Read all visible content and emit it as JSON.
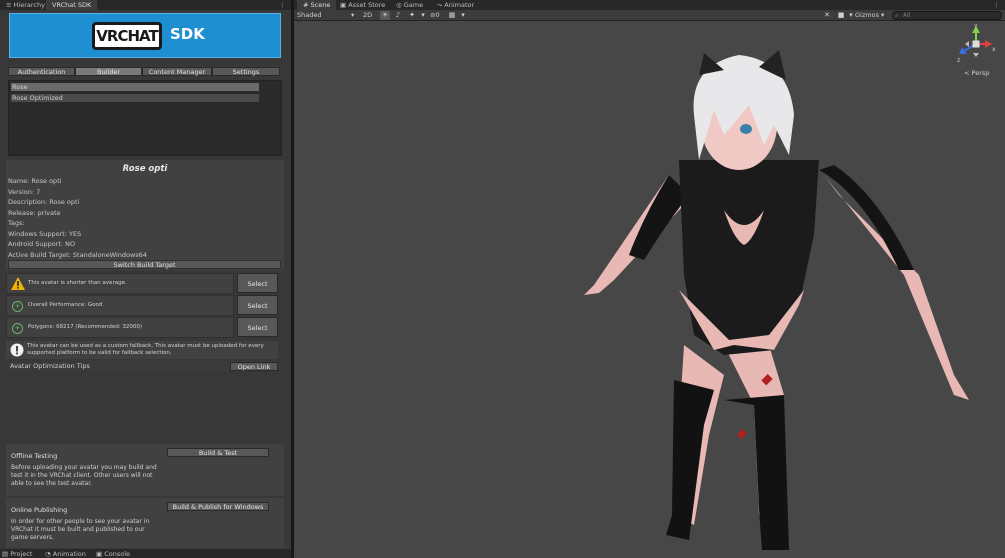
{
  "left_tabs": [
    "Hierarchy",
    "VRChat SDK"
  ],
  "banner": {
    "logo": "VRCHAT",
    "sdk": "SDK"
  },
  "sdk_tabs": [
    "Authentication",
    "Builder",
    "Content Manager",
    "Settings"
  ],
  "avatar_list": [
    "Rose",
    "Rose Optimized"
  ],
  "info": {
    "title": "Rose opti",
    "lines": [
      "Name: Rose opti",
      "Version: 7",
      "Description: Rose opti",
      "Release: private",
      "Tags:",
      "Windows Support: YES",
      "Android Support: NO",
      "Active Build Target: StandaloneWindows64"
    ],
    "switch_button": "Switch Build Target"
  },
  "warnings": [
    {
      "icon": "warning-icon",
      "text": "This avatar is shorter than average.",
      "button": "Select"
    },
    {
      "icon": "ok-icon",
      "text": "Overall Performance: Good",
      "button": "Select"
    },
    {
      "icon": "ok-icon",
      "text": "Polygons: 68217 (Recommended: 32000)",
      "button": "Select"
    }
  ],
  "fallback_text": "This avatar can be used as a custom fallback. This avatar must be uploaded for every supported platform to be valid for fallback selection.",
  "tips": {
    "label": "Avatar Optimization Tips",
    "button": "Open Link"
  },
  "offline": {
    "title": "Offline Testing",
    "button": "Build & Test",
    "text": "Before uploading your avatar you may build and test it in the VRChat client. Other users will not able to see the test avatar."
  },
  "online": {
    "title": "Online Publishing",
    "button": "Build & Publish for Windows",
    "text": "In order for other people to see your avatar in VRChat it must be built and published to our game servers."
  },
  "bottom_tabs": [
    "Project",
    "Animation",
    "Console"
  ],
  "scene_tabs": [
    "Scene",
    "Asset Store",
    "Game",
    "Animator"
  ],
  "toolbar": {
    "shading": "Shaded",
    "mode2d": "2D",
    "layers_count": "0",
    "gizmos": "Gizmos",
    "search_placeholder": "All"
  },
  "persp_label": "Persp",
  "gizmo_axes": {
    "y": "y",
    "x": "x",
    "z": "z"
  },
  "colors": {
    "banner": "#1e8fd0",
    "ok": "#6ab46a",
    "warn": "#f0b400",
    "scene_bg": "#474747"
  }
}
